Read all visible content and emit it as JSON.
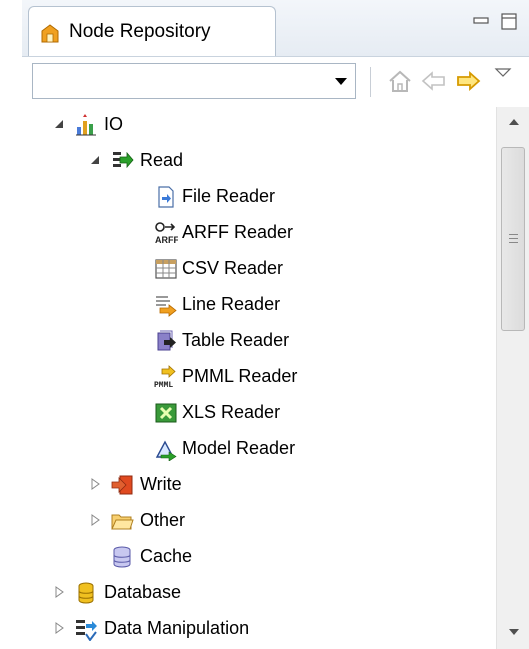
{
  "view": {
    "title": "Node Repository",
    "icon": "node-repository-icon",
    "minimize": "minimize-icon",
    "maximize": "maximize-icon"
  },
  "toolbar": {
    "search_value": "",
    "buttons": [
      "home-icon",
      "back-arrow-icon",
      "forward-arrow-icon",
      "view-menu-icon"
    ]
  },
  "tree": [
    {
      "label": "IO",
      "icon": "io-icon",
      "level": 0,
      "expanded": true
    },
    {
      "label": "Read",
      "icon": "read-icon",
      "level": 1,
      "expanded": true
    },
    {
      "label": "File Reader",
      "icon": "file-reader-icon",
      "level": 2
    },
    {
      "label": "ARFF Reader",
      "icon": "arff-reader-icon",
      "level": 2
    },
    {
      "label": "CSV Reader",
      "icon": "csv-reader-icon",
      "level": 2
    },
    {
      "label": "Line Reader",
      "icon": "line-reader-icon",
      "level": 2
    },
    {
      "label": "Table Reader",
      "icon": "table-reader-icon",
      "level": 2
    },
    {
      "label": "PMML Reader",
      "icon": "pmml-reader-icon",
      "level": 2
    },
    {
      "label": "XLS Reader",
      "icon": "xls-reader-icon",
      "level": 2
    },
    {
      "label": "Model Reader",
      "icon": "model-reader-icon",
      "level": 2
    },
    {
      "label": "Write",
      "icon": "write-icon",
      "level": 1,
      "expanded": false
    },
    {
      "label": "Other",
      "icon": "folder-icon",
      "level": 1,
      "expanded": false
    },
    {
      "label": "Cache",
      "icon": "cache-icon",
      "level": 1
    },
    {
      "label": "Database",
      "icon": "database-icon",
      "level": 0,
      "expanded": false
    },
    {
      "label": "Data Manipulation",
      "icon": "data-manipulation-icon",
      "level": 0,
      "expanded": false
    }
  ],
  "scrollbar": {
    "position": 0.0
  }
}
